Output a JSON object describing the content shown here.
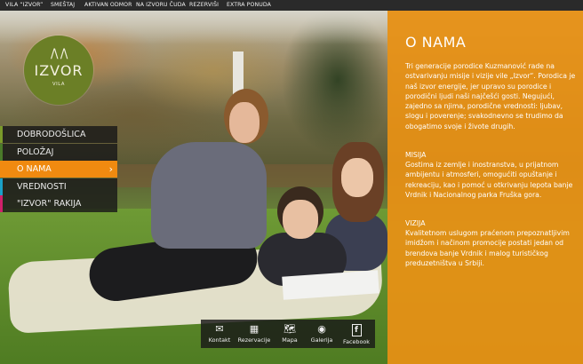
{
  "top_menu": [
    "VILA “IZVOR”",
    "SMEŠTAJ",
    "AKTIVAN ODMOR",
    "NA IZVORU ČUDA",
    "REZERVIŠI",
    "EXTRA PONUDA"
  ],
  "logo": {
    "mark": "/\\ /\\",
    "name": "IZVOR",
    "sub": "VILA"
  },
  "nav": [
    {
      "label": "DOBRODOŠLICA",
      "color": "#7a9a2a"
    },
    {
      "label": "POLOŽAJ",
      "color": "#4a7a2a"
    },
    {
      "label": "O NAMA",
      "color": "#f08a10",
      "active": true
    },
    {
      "label": "VREDNOSTI",
      "color": "#1aa0c8"
    },
    {
      "label": "\"IZVOR\" RAKIJA",
      "color": "#d0206a"
    }
  ],
  "panel": {
    "title": "O NAMA",
    "intro": "Tri generacije porodice Kuzmanović rade na ostvarivanju misije i vizije vile „Izvor“. Porodica je naš izvor energije, jer upravo su porodice i porodični ljudi naši najčešći gosti. Negujući, zajedno sa njima, porodične vrednosti: ljubav, slogu i poverenje; svakodnevno se trudimo da obogatimo svoje i živote drugih.",
    "misija_title": "MISIJA",
    "misija_text": "Gostima iz zemlje i inostranstva, u prijatnom ambijentu i atmosferi, omogućiti opuštanje i rekreaciju, kao i pomoć u otkrivanju lepota banje Vrdnik i Nacionalnog parka Fruška gora.",
    "vizija_title": "VIZIJA",
    "vizija_text": "Kvalitetnom uslugom praćenom prepoznatljivim imidžom i načinom promocije postati jedan od brendova banje Vrdnik i malog turističkog preduzetništva u Srbiji."
  },
  "bottom_bar": [
    {
      "label": "Kontakt",
      "icon": "envelope-icon",
      "glyph": "✉"
    },
    {
      "label": "Rezervacije",
      "icon": "calendar-icon",
      "glyph": "▦"
    },
    {
      "label": "Mapa",
      "icon": "map-icon",
      "glyph": "🗺"
    },
    {
      "label": "Galerija",
      "icon": "camera-icon",
      "glyph": "◉"
    },
    {
      "label": "Facebook",
      "icon": "facebook-icon",
      "glyph": "f"
    }
  ],
  "colors": {
    "accent": "#f08a10",
    "panel": "#e89114",
    "logo": "#6b7f26",
    "dark": "#2a2a2a"
  }
}
